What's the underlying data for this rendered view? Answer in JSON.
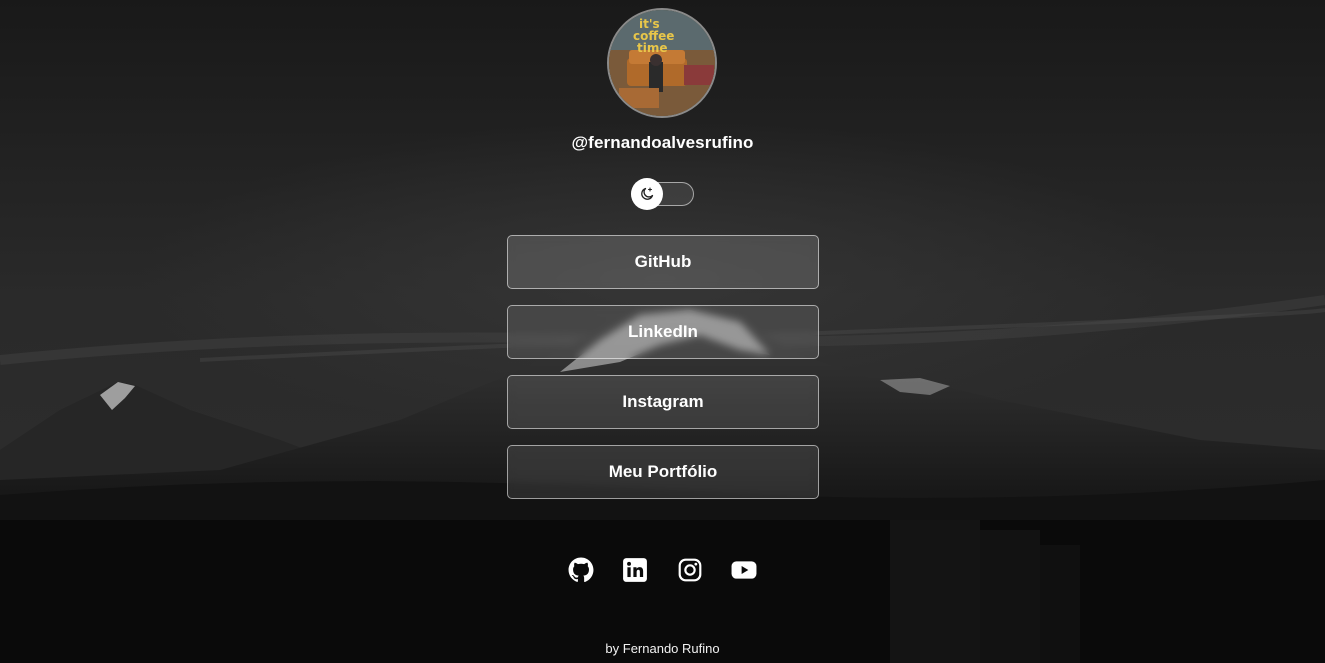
{
  "profile": {
    "username": "@fernandoalvesrufino",
    "avatar_alt": "profile-avatar"
  },
  "theme_toggle": {
    "icon": "moon-sparkle-icon",
    "state": "dark"
  },
  "links": [
    {
      "label": "GitHub"
    },
    {
      "label": "LinkedIn"
    },
    {
      "label": "Instagram"
    },
    {
      "label": "Meu Portfólio"
    }
  ],
  "social_icons": [
    {
      "icon": "github-icon"
    },
    {
      "icon": "linkedin-icon"
    },
    {
      "icon": "instagram-icon"
    },
    {
      "icon": "youtube-icon"
    }
  ],
  "footer": {
    "text": "by Fernando Rufino"
  },
  "colors": {
    "background": "#1a1a1a",
    "text": "#ffffff",
    "button_border": "#bdbdbd"
  }
}
